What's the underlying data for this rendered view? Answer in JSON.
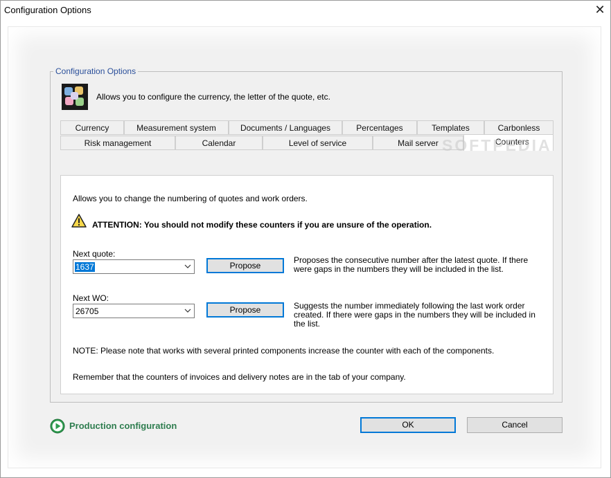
{
  "window": {
    "title": "Configuration Options"
  },
  "group": {
    "legend": "Configuration Options",
    "icon": "puzzle-icon",
    "description": "Allows you to configure the currency, the letter of the quote, etc."
  },
  "tabs": {
    "row1": [
      "Currency",
      "Measurement system",
      "Documents / Languages",
      "Percentages",
      "Templates",
      "Carbonless"
    ],
    "row2": [
      "Risk management",
      "Calendar",
      "Level of service",
      "Mail server",
      "Counters"
    ],
    "active": "Counters"
  },
  "counters": {
    "intro": "Allows you to change the numbering of quotes and work orders.",
    "warning": "ATTENTION: You should not modify these counters if you are unsure of the operation.",
    "next_quote": {
      "label": "Next quote:",
      "value": "1637",
      "button": "Propose",
      "desc": "Proposes the consecutive number after the latest quote. If there were gaps in the numbers they will be included in the list."
    },
    "next_wo": {
      "label": "Next WO:",
      "value": "26705",
      "button": "Propose",
      "desc": "Suggests the number immediately following the last work order created. If there were gaps in the numbers they will be included in the list."
    },
    "note": "NOTE: Please note that works with several printed components increase the counter with each of the components.",
    "remember": "Remember that the counters of invoices and delivery notes are in the tab of your company."
  },
  "footer": {
    "production_label": "Production configuration",
    "ok_label": "OK",
    "cancel_label": "Cancel"
  },
  "watermark": "SOFTPEDIA",
  "colors": {
    "accent": "#0078d7",
    "legend": "#2a4f9a",
    "production": "#2e7d4f"
  }
}
